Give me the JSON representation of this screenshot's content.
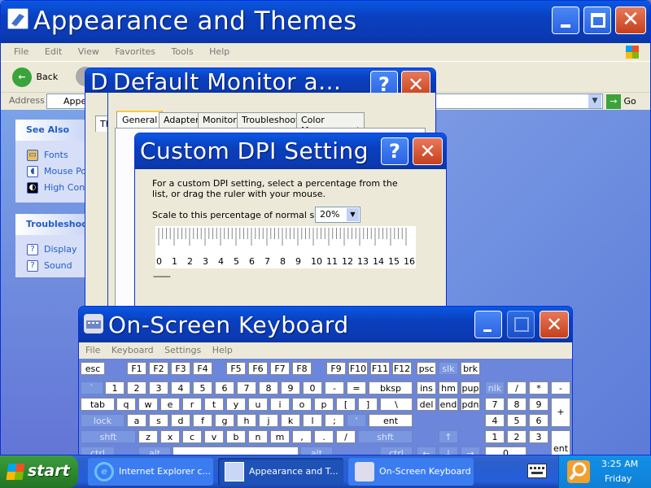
{
  "explorer": {
    "title": "Appearance and Themes",
    "menu": [
      "File",
      "Edit",
      "View",
      "Favorites",
      "Tools",
      "Help"
    ],
    "back": "Back",
    "address_label": "Address",
    "address_value": "Appea",
    "go": "Go",
    "see_also": {
      "header": "See Also",
      "items": [
        "Fonts",
        "Mouse Pointers",
        "High Contrast"
      ]
    },
    "troubleshoot": {
      "header": "Troubleshooters",
      "items": [
        "Display",
        "Sound"
      ]
    }
  },
  "display_props": {
    "title_initial": "D",
    "tab_initial": "Th"
  },
  "monitor": {
    "title": "Default Monitor a...",
    "tabs": [
      "General",
      "Adapter",
      "Monitor",
      "Troubleshoot",
      "Color Management"
    ]
  },
  "dpi": {
    "title": "Custom DPI Setting",
    "help": "For a custom DPI setting, select a percentage from the list, or drag the ruler with your mouse.",
    "scale_label": "Scale to this percentage of normal size:",
    "scale_value": "20%",
    "ruler": [
      "0",
      "1",
      "2",
      "3",
      "4",
      "5",
      "6",
      "7",
      "8",
      "9",
      "10",
      "11",
      "12",
      "13",
      "14",
      "15",
      "16"
    ],
    "sample": "--------"
  },
  "osk": {
    "title": "On-Screen Keyboard",
    "menu": [
      "File",
      "Keyboard",
      "Settings",
      "Help"
    ],
    "keys": [
      {
        "k": "esc",
        "row": 0,
        "c": 98,
        "w": 30
      },
      {
        "k": "F1",
        "row": 0,
        "c": 155,
        "w": 24
      },
      {
        "k": "F2",
        "row": 0,
        "c": 182,
        "w": 24
      },
      {
        "k": "F3",
        "row": 0,
        "c": 209,
        "w": 24
      },
      {
        "k": "F4",
        "row": 0,
        "c": 236,
        "w": 24
      },
      {
        "k": "F5",
        "row": 0,
        "c": 277,
        "w": 24
      },
      {
        "k": "F6",
        "row": 0,
        "c": 304,
        "w": 24
      },
      {
        "k": "F7",
        "row": 0,
        "c": 331,
        "w": 24
      },
      {
        "k": "F8",
        "row": 0,
        "c": 358,
        "w": 24
      },
      {
        "k": "F9",
        "row": 0,
        "c": 400,
        "w": 24
      },
      {
        "k": "F10",
        "row": 0,
        "c": 427,
        "w": 24
      },
      {
        "k": "F11",
        "row": 0,
        "c": 454,
        "w": 24
      },
      {
        "k": "F12",
        "row": 0,
        "c": 481,
        "w": 24
      },
      {
        "k": "psc",
        "row": 0,
        "c": 511,
        "w": 24
      },
      {
        "k": "slk",
        "row": 0,
        "c": 538,
        "w": 24,
        "d": true
      },
      {
        "k": "brk",
        "row": 0,
        "c": 565,
        "w": 24
      },
      {
        "k": "`",
        "row": 1,
        "c": 98,
        "w": 28,
        "d": true
      },
      {
        "k": "1",
        "row": 1,
        "c": 128,
        "w": 24
      },
      {
        "k": "2",
        "row": 1,
        "c": 155,
        "w": 24
      },
      {
        "k": "3",
        "row": 1,
        "c": 182,
        "w": 24
      },
      {
        "k": "4",
        "row": 1,
        "c": 209,
        "w": 24
      },
      {
        "k": "5",
        "row": 1,
        "c": 236,
        "w": 24
      },
      {
        "k": "6",
        "row": 1,
        "c": 263,
        "w": 24
      },
      {
        "k": "7",
        "row": 1,
        "c": 290,
        "w": 24
      },
      {
        "k": "8",
        "row": 1,
        "c": 317,
        "w": 24
      },
      {
        "k": "9",
        "row": 1,
        "c": 344,
        "w": 24
      },
      {
        "k": "0",
        "row": 1,
        "c": 371,
        "w": 24
      },
      {
        "k": "-",
        "row": 1,
        "c": 398,
        "w": 24
      },
      {
        "k": "=",
        "row": 1,
        "c": 425,
        "w": 24
      },
      {
        "k": "bksp",
        "row": 1,
        "c": 452,
        "w": 54
      },
      {
        "k": "ins",
        "row": 1,
        "c": 511,
        "w": 24
      },
      {
        "k": "hm",
        "row": 1,
        "c": 538,
        "w": 24
      },
      {
        "k": "pup",
        "row": 1,
        "c": 565,
        "w": 24
      },
      {
        "k": "nlk",
        "row": 1,
        "c": 595,
        "w": 24,
        "d": true
      },
      {
        "k": "/",
        "row": 1,
        "c": 622,
        "w": 24
      },
      {
        "k": "*",
        "row": 1,
        "c": 649,
        "w": 24
      },
      {
        "k": "-",
        "row": 1,
        "c": 676,
        "w": 24
      },
      {
        "k": "tab",
        "row": 2,
        "c": 98,
        "w": 42
      },
      {
        "k": "q",
        "row": 2,
        "c": 142,
        "w": 24
      },
      {
        "k": "w",
        "row": 2,
        "c": 169,
        "w": 24
      },
      {
        "k": "e",
        "row": 2,
        "c": 196,
        "w": 24
      },
      {
        "k": "r",
        "row": 2,
        "c": 223,
        "w": 24
      },
      {
        "k": "t",
        "row": 2,
        "c": 250,
        "w": 24
      },
      {
        "k": "y",
        "row": 2,
        "c": 277,
        "w": 24
      },
      {
        "k": "u",
        "row": 2,
        "c": 304,
        "w": 24
      },
      {
        "k": "i",
        "row": 2,
        "c": 331,
        "w": 24
      },
      {
        "k": "o",
        "row": 2,
        "c": 358,
        "w": 24
      },
      {
        "k": "p",
        "row": 2,
        "c": 385,
        "w": 24
      },
      {
        "k": "[",
        "row": 2,
        "c": 412,
        "w": 24
      },
      {
        "k": "]",
        "row": 2,
        "c": 439,
        "w": 24
      },
      {
        "k": "\\",
        "row": 2,
        "c": 466,
        "w": 40
      },
      {
        "k": "del",
        "row": 2,
        "c": 511,
        "w": 24
      },
      {
        "k": "end",
        "row": 2,
        "c": 538,
        "w": 24
      },
      {
        "k": "pdn",
        "row": 2,
        "c": 565,
        "w": 24
      },
      {
        "k": "7",
        "row": 2,
        "c": 595,
        "w": 24
      },
      {
        "k": "8",
        "row": 2,
        "c": 622,
        "w": 24
      },
      {
        "k": "9",
        "row": 2,
        "c": 649,
        "w": 24
      },
      {
        "k": "lock",
        "row": 3,
        "c": 98,
        "w": 54,
        "d": true
      },
      {
        "k": "a",
        "row": 3,
        "c": 155,
        "w": 24
      },
      {
        "k": "s",
        "row": 3,
        "c": 182,
        "w": 24
      },
      {
        "k": "d",
        "row": 3,
        "c": 209,
        "w": 24
      },
      {
        "k": "f",
        "row": 3,
        "c": 236,
        "w": 24
      },
      {
        "k": "g",
        "row": 3,
        "c": 263,
        "w": 24
      },
      {
        "k": "h",
        "row": 3,
        "c": 290,
        "w": 24
      },
      {
        "k": "j",
        "row": 3,
        "c": 317,
        "w": 24
      },
      {
        "k": "k",
        "row": 3,
        "c": 344,
        "w": 24
      },
      {
        "k": "l",
        "row": 3,
        "c": 371,
        "w": 24
      },
      {
        "k": ";",
        "row": 3,
        "c": 398,
        "w": 24
      },
      {
        "k": "'",
        "row": 3,
        "c": 425,
        "w": 24,
        "d": true
      },
      {
        "k": "ent",
        "row": 3,
        "c": 452,
        "w": 54
      },
      {
        "k": "4",
        "row": 3,
        "c": 595,
        "w": 24
      },
      {
        "k": "5",
        "row": 3,
        "c": 622,
        "w": 24
      },
      {
        "k": "6",
        "row": 3,
        "c": 649,
        "w": 24
      },
      {
        "k": "shft",
        "row": 4,
        "c": 98,
        "w": 68,
        "d": true
      },
      {
        "k": "z",
        "row": 4,
        "c": 169,
        "w": 24
      },
      {
        "k": "x",
        "row": 4,
        "c": 196,
        "w": 24
      },
      {
        "k": "c",
        "row": 4,
        "c": 223,
        "w": 24
      },
      {
        "k": "v",
        "row": 4,
        "c": 250,
        "w": 24
      },
      {
        "k": "b",
        "row": 4,
        "c": 277,
        "w": 24
      },
      {
        "k": "n",
        "row": 4,
        "c": 304,
        "w": 24
      },
      {
        "k": "m",
        "row": 4,
        "c": 331,
        "w": 24
      },
      {
        "k": ",",
        "row": 4,
        "c": 358,
        "w": 24
      },
      {
        "k": ".",
        "row": 4,
        "c": 385,
        "w": 24
      },
      {
        "k": "/",
        "row": 4,
        "c": 412,
        "w": 24
      },
      {
        "k": "shft",
        "row": 4,
        "c": 439,
        "w": 67,
        "d": true
      },
      {
        "k": "↑",
        "row": 4,
        "c": 538,
        "w": 24,
        "d": true
      },
      {
        "k": "1",
        "row": 4,
        "c": 595,
        "w": 24
      },
      {
        "k": "2",
        "row": 4,
        "c": 622,
        "w": 24
      },
      {
        "k": "3",
        "row": 4,
        "c": 649,
        "w": 24
      },
      {
        "k": "ctrl",
        "row": 5,
        "c": 98,
        "w": 42,
        "d": true
      },
      {
        "k": "alt",
        "row": 5,
        "c": 169,
        "w": 40,
        "d": true
      },
      {
        "k": "",
        "row": 5,
        "c": 211,
        "w": 155
      },
      {
        "k": "alt",
        "row": 5,
        "c": 368,
        "w": 40,
        "d": true
      },
      {
        "k": "ctrl",
        "row": 5,
        "c": 466,
        "w": 40,
        "d": true
      },
      {
        "k": "←",
        "row": 5,
        "c": 511,
        "w": 24,
        "d": true
      },
      {
        "k": "↓",
        "row": 5,
        "c": 538,
        "w": 24,
        "d": true
      },
      {
        "k": "→",
        "row": 5,
        "c": 565,
        "w": 24,
        "d": true
      },
      {
        "k": "0",
        "row": 5,
        "c": 595,
        "w": 51
      }
    ],
    "plus": "+",
    "ent2": "ent"
  },
  "taskbar": {
    "start": "start",
    "tasks": [
      "Internet Explorer c...",
      "Appearance and T...",
      "On-Screen Keyboard"
    ],
    "time": "3:25 AM",
    "day": "Friday"
  }
}
